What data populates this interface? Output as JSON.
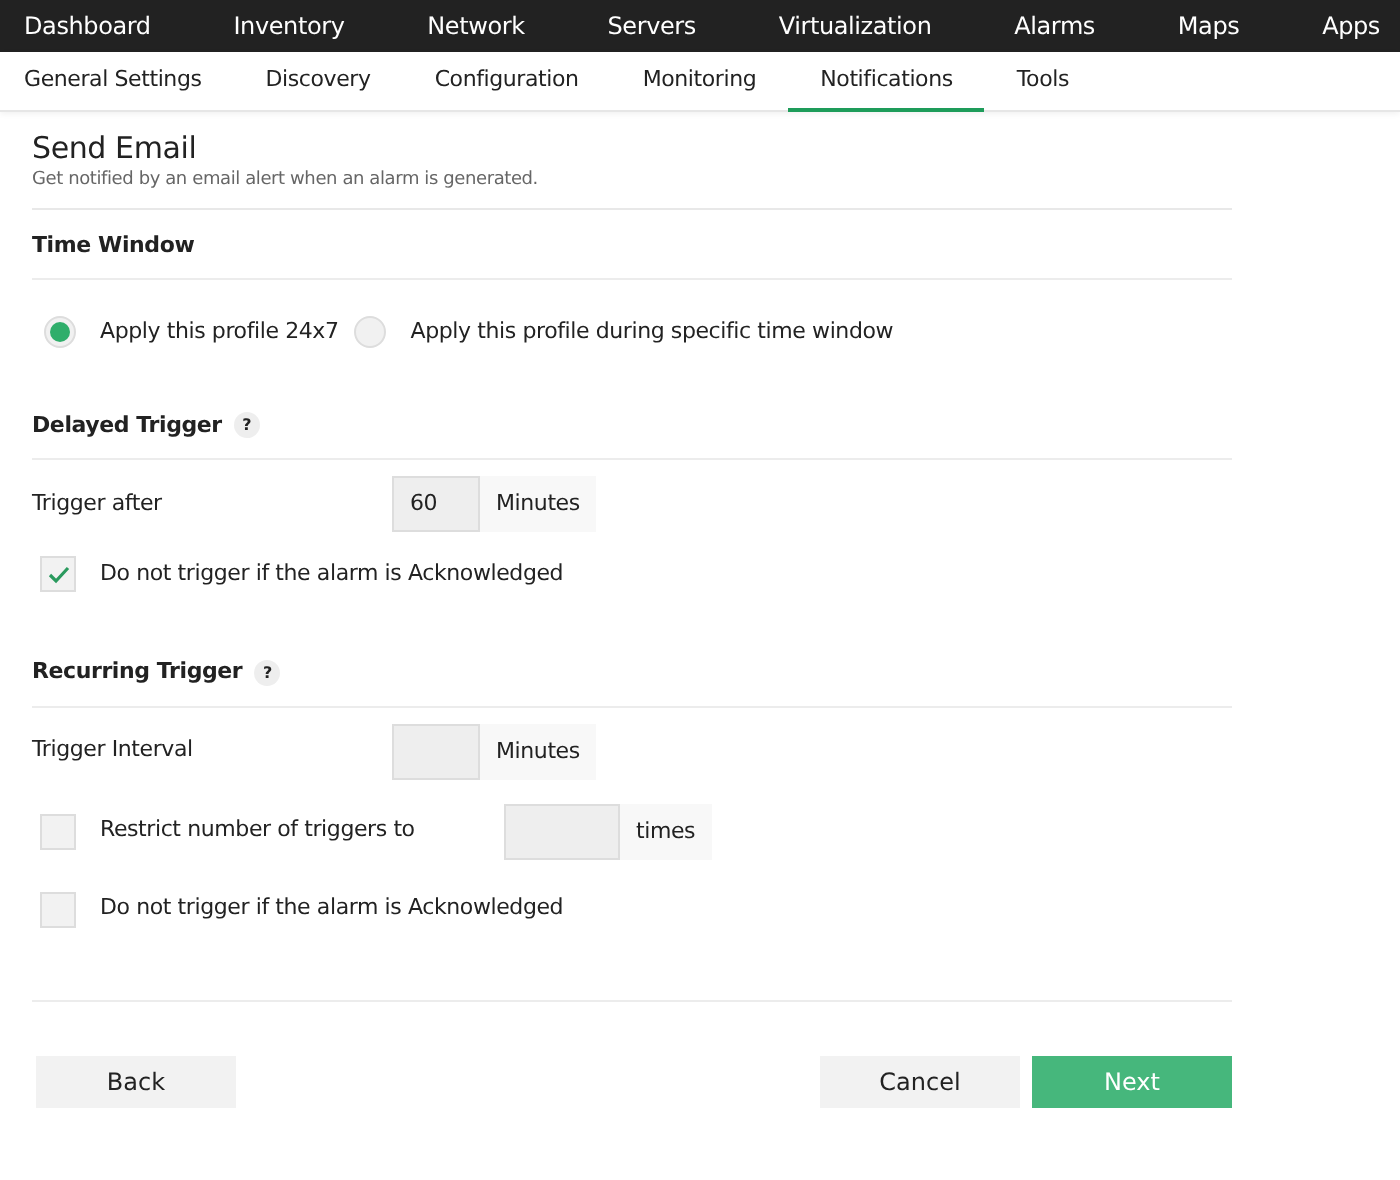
{
  "main_nav": [
    {
      "label": "Dashboard"
    },
    {
      "label": "Inventory"
    },
    {
      "label": "Network"
    },
    {
      "label": "Servers"
    },
    {
      "label": "Virtualization"
    },
    {
      "label": "Alarms"
    },
    {
      "label": "Maps"
    },
    {
      "label": "Apps"
    }
  ],
  "sub_tabs": [
    {
      "label": "General Settings",
      "selected": false
    },
    {
      "label": "Discovery",
      "selected": false
    },
    {
      "label": "Configuration",
      "selected": false
    },
    {
      "label": "Monitoring",
      "selected": false
    },
    {
      "label": "Notifications",
      "selected": true
    },
    {
      "label": "Tools",
      "selected": false
    }
  ],
  "page": {
    "title": "Send Email",
    "subtitle": "Get notified by an email alert when an alarm is generated."
  },
  "sections": [
    {
      "title": "Time Window",
      "rows": [
        {
          "kind": "radios",
          "options": [
            {
              "label": "Apply this profile 24x7",
              "selected": true
            },
            {
              "label": "Apply this profile during specific time window",
              "selected": false
            }
          ]
        }
      ]
    },
    {
      "title": "Delayed Trigger",
      "help": "?",
      "rows": [
        {
          "kind": "input",
          "label": "Trigger after",
          "value": "60",
          "unit": "Minutes"
        },
        {
          "kind": "checkbox",
          "label": "Do not trigger if the alarm is Acknowledged",
          "checked": true
        }
      ]
    },
    {
      "title": "Recurring Trigger",
      "help": "?",
      "rows": [
        {
          "kind": "input",
          "label": "Trigger Interval",
          "unit": "Minutes"
        },
        {
          "kind": "checkbox_input",
          "label": "Restrict number of triggers to",
          "checked": false,
          "unit": "times"
        },
        {
          "kind": "checkbox",
          "label": "Do not trigger if the alarm is Acknowledged",
          "checked": false
        }
      ]
    }
  ],
  "buttons": [
    {
      "label": "Back",
      "kind": "secondary"
    },
    {
      "label": "Cancel",
      "kind": "secondary"
    },
    {
      "label": "Next",
      "kind": "primary"
    }
  ]
}
